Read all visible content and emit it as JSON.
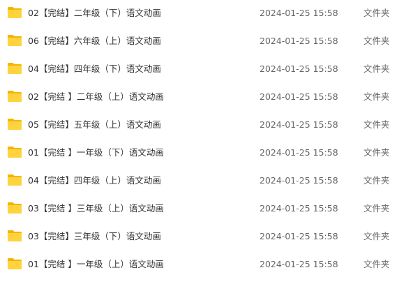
{
  "files": [
    {
      "name": "02【完结】二年级（下）语文动画",
      "modified": "2024-01-25 15:58",
      "type": "文件夹",
      "icon": "folder-icon"
    },
    {
      "name": "06【完结】六年级（上）语文动画",
      "modified": "2024-01-25 15:58",
      "type": "文件夹",
      "icon": "folder-icon"
    },
    {
      "name": "04【完结】四年级（下）语文动画",
      "modified": "2024-01-25 15:58",
      "type": "文件夹",
      "icon": "folder-icon"
    },
    {
      "name": "02【完结 】二年级（上）语文动画",
      "modified": "2024-01-25 15:58",
      "type": "文件夹",
      "icon": "folder-icon"
    },
    {
      "name": "05【完结】五年级（上）语文动画",
      "modified": "2024-01-25 15:58",
      "type": "文件夹",
      "icon": "folder-icon"
    },
    {
      "name": "01【完结 】一年级（下）语文动画",
      "modified": "2024-01-25 15:58",
      "type": "文件夹",
      "icon": "folder-icon"
    },
    {
      "name": "04【完结】四年级（上）语文动画",
      "modified": "2024-01-25 15:58",
      "type": "文件夹",
      "icon": "folder-icon"
    },
    {
      "name": "03【完结 】三年级（上）语文动画",
      "modified": "2024-01-25 15:58",
      "type": "文件夹",
      "icon": "folder-icon"
    },
    {
      "name": "03【完结】三年级（下）语文动画",
      "modified": "2024-01-25 15:58",
      "type": "文件夹",
      "icon": "folder-icon"
    },
    {
      "name": "01【完结 】一年级（上）语文动画",
      "modified": "2024-01-25 15:58",
      "type": "文件夹",
      "icon": "folder-icon"
    }
  ],
  "colors": {
    "folder_back": "#F5B400",
    "folder_front": "#FFD33D",
    "text": "#333333",
    "muted_text": "#666666"
  }
}
